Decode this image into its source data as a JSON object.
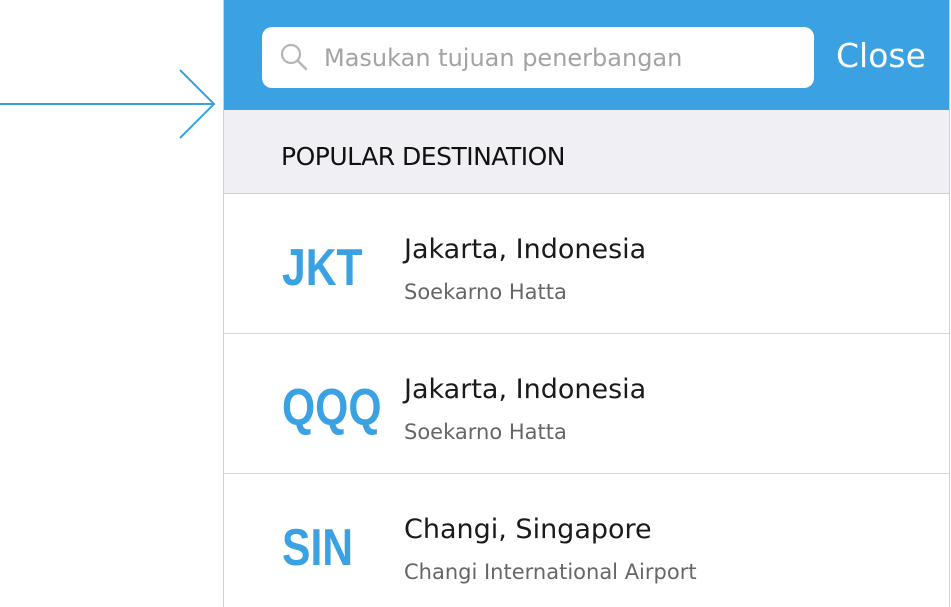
{
  "search": {
    "placeholder": "Masukan tujuan penerbangan",
    "value": ""
  },
  "header": {
    "close_label": "Close",
    "accent_color": "#3aa1e3"
  },
  "section": {
    "title": "POPULAR DESTINATION"
  },
  "destinations": [
    {
      "code": "JKT",
      "city": "Jakarta, Indonesia",
      "airport": "Soekarno Hatta"
    },
    {
      "code": "QQQ",
      "city": "Jakarta, Indonesia",
      "airport": "Soekarno Hatta"
    },
    {
      "code": "SIN",
      "city": "Changi, Singapore",
      "airport": "Changi International Airport"
    }
  ],
  "icons": {
    "search": "search-icon",
    "pointer": "arrow-right-icon"
  }
}
